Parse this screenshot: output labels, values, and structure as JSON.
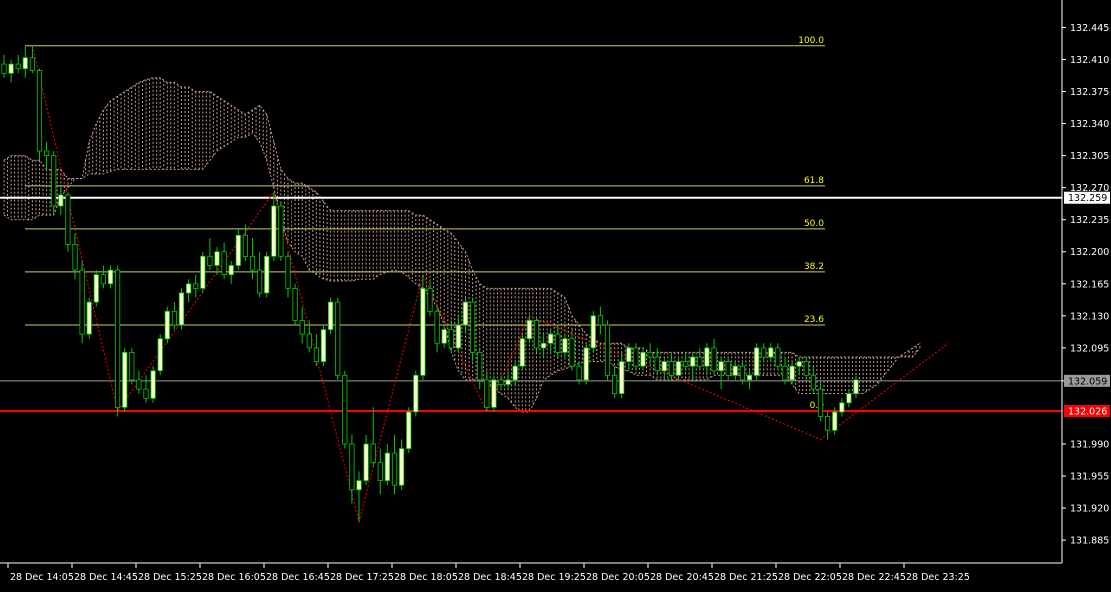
{
  "chart_data": {
    "type": "candlestick",
    "price_range": [
      131.86,
      132.475
    ],
    "y_ticks": [
      "132.445",
      "132.410",
      "132.375",
      "132.340",
      "132.305",
      "132.270",
      "132.235",
      "132.200",
      "132.165",
      "132.130",
      "132.095",
      "132.059",
      "131.990",
      "131.955",
      "131.920",
      "131.885"
    ],
    "x_labels": [
      "28 Dec 14:05",
      "28 Dec 14:45",
      "28 Dec 15:25",
      "28 Dec 16:05",
      "28 Dec 16:45",
      "28 Dec 17:25",
      "28 Dec 18:05",
      "28 Dec 18:45",
      "28 Dec 19:25",
      "28 Dec 20:05",
      "28 Dec 20:45",
      "28 Dec 21:25",
      "28 Dec 22:05",
      "28 Dec 22:45",
      "28 Dec 23:25"
    ],
    "price_markers": [
      {
        "label": "132.259",
        "value": 132.259,
        "color": "#ffffff",
        "text_color": "#000000",
        "line_width": 2
      },
      {
        "label": "132.059",
        "value": 132.059,
        "color": "#9a9a9a",
        "text_color": "#000000",
        "line_width": 1
      },
      {
        "label": "132.026",
        "value": 132.026,
        "color": "#ff0000",
        "text_color": "#ffffff",
        "line_width": 2
      }
    ],
    "fib_levels": [
      {
        "label": "100.0",
        "value": 132.425
      },
      {
        "label": "61.8",
        "value": 132.272
      },
      {
        "label": "50.0",
        "value": 132.225
      },
      {
        "label": "38.2",
        "value": 132.178
      },
      {
        "label": "23.6",
        "value": 132.12
      },
      {
        "label": "0.0",
        "value": 132.026
      }
    ],
    "colors": {
      "background": "#000000",
      "bull_body": "#ffffcc",
      "bear_body": "#000000",
      "wick": "#00cc00",
      "fib_line": "#cccc66",
      "fib_text": "#ffff00",
      "cloud": "#c49b8a",
      "zigzag": "#ff0000",
      "axis_text": "#ffffff"
    },
    "candles": [
      [
        132.405,
        132.415,
        132.39,
        132.395
      ],
      [
        132.395,
        132.41,
        132.385,
        132.405
      ],
      [
        132.405,
        132.415,
        132.395,
        132.4
      ],
      [
        132.4,
        132.425,
        132.39,
        132.412
      ],
      [
        132.412,
        132.425,
        132.395,
        132.398
      ],
      [
        132.398,
        132.4,
        132.3,
        132.31
      ],
      [
        132.31,
        132.32,
        132.29,
        132.305
      ],
      [
        132.305,
        132.31,
        132.24,
        132.25
      ],
      [
        132.25,
        132.27,
        132.24,
        132.262
      ],
      [
        132.262,
        132.265,
        132.2,
        132.208
      ],
      [
        132.208,
        132.22,
        132.17,
        132.18
      ],
      [
        132.18,
        132.19,
        132.1,
        132.11
      ],
      [
        132.11,
        132.15,
        132.105,
        132.145
      ],
      [
        132.145,
        132.18,
        132.14,
        132.175
      ],
      [
        132.175,
        132.185,
        132.16,
        132.165
      ],
      [
        132.165,
        132.185,
        132.16,
        132.18
      ],
      [
        132.18,
        132.185,
        132.02,
        132.03
      ],
      [
        132.03,
        132.095,
        132.025,
        132.09
      ],
      [
        132.09,
        132.095,
        132.055,
        132.06
      ],
      [
        132.06,
        132.07,
        132.045,
        132.05
      ],
      [
        132.05,
        132.065,
        132.035,
        132.04
      ],
      [
        132.04,
        132.075,
        132.035,
        132.07
      ],
      [
        132.07,
        132.11,
        132.065,
        132.105
      ],
      [
        132.105,
        132.14,
        132.1,
        132.135
      ],
      [
        132.135,
        132.145,
        132.115,
        132.12
      ],
      [
        132.12,
        132.16,
        132.115,
        132.155
      ],
      [
        132.155,
        132.17,
        132.145,
        132.165
      ],
      [
        132.165,
        132.175,
        132.15,
        132.16
      ],
      [
        132.16,
        132.2,
        132.155,
        132.195
      ],
      [
        132.195,
        132.215,
        132.18,
        132.185
      ],
      [
        132.185,
        132.205,
        132.175,
        132.2
      ],
      [
        132.2,
        132.21,
        132.17,
        132.175
      ],
      [
        132.175,
        132.19,
        132.165,
        132.185
      ],
      [
        132.185,
        132.225,
        132.18,
        132.218
      ],
      [
        132.218,
        132.23,
        132.19,
        132.195
      ],
      [
        132.195,
        132.215,
        132.17,
        132.18
      ],
      [
        132.18,
        132.2,
        132.15,
        132.155
      ],
      [
        132.155,
        132.2,
        132.15,
        132.195
      ],
      [
        132.195,
        132.265,
        132.19,
        132.25
      ],
      [
        132.25,
        132.255,
        132.19,
        132.195
      ],
      [
        132.195,
        132.2,
        132.15,
        132.16
      ],
      [
        132.16,
        132.165,
        132.12,
        132.125
      ],
      [
        132.125,
        132.14,
        132.1,
        132.11
      ],
      [
        132.11,
        132.125,
        132.09,
        132.095
      ],
      [
        132.095,
        132.11,
        132.075,
        132.08
      ],
      [
        132.08,
        132.12,
        132.075,
        132.115
      ],
      [
        132.115,
        132.15,
        132.11,
        132.145
      ],
      [
        132.145,
        132.15,
        132.06,
        132.065
      ],
      [
        132.065,
        132.07,
        131.985,
        131.99
      ],
      [
        131.99,
        132.0,
        131.925,
        131.94
      ],
      [
        131.94,
        131.96,
        131.905,
        131.95
      ],
      [
        131.95,
        132.0,
        131.945,
        131.99
      ],
      [
        131.99,
        132.03,
        131.965,
        131.97
      ],
      [
        131.97,
        131.985,
        131.935,
        131.95
      ],
      [
        131.95,
        131.99,
        131.945,
        131.98
      ],
      [
        131.98,
        132.0,
        131.935,
        131.945
      ],
      [
        131.945,
        131.995,
        131.94,
        131.985
      ],
      [
        131.985,
        132.03,
        131.98,
        132.025
      ],
      [
        132.025,
        132.07,
        132.02,
        132.065
      ],
      [
        132.065,
        132.175,
        132.06,
        132.16
      ],
      [
        132.16,
        132.17,
        132.13,
        132.135
      ],
      [
        132.135,
        132.14,
        132.09,
        132.1
      ],
      [
        132.1,
        132.12,
        132.095,
        132.115
      ],
      [
        132.115,
        132.125,
        132.09,
        132.095
      ],
      [
        132.095,
        132.13,
        132.09,
        132.12
      ],
      [
        132.12,
        132.15,
        132.11,
        132.145
      ],
      [
        132.145,
        132.15,
        132.08,
        132.09
      ],
      [
        132.09,
        132.095,
        132.05,
        132.06
      ],
      [
        132.06,
        132.07,
        132.025,
        132.03
      ],
      [
        132.03,
        132.065,
        132.025,
        132.06
      ],
      [
        132.06,
        132.065,
        132.05,
        132.055
      ],
      [
        132.055,
        132.07,
        132.05,
        132.06
      ],
      [
        132.06,
        132.08,
        132.055,
        132.075
      ],
      [
        132.075,
        132.11,
        132.07,
        132.105
      ],
      [
        132.105,
        132.13,
        132.1,
        132.125
      ],
      [
        132.125,
        132.13,
        132.09,
        132.095
      ],
      [
        132.095,
        132.11,
        132.085,
        132.1
      ],
      [
        132.1,
        132.115,
        132.09,
        132.11
      ],
      [
        132.11,
        132.12,
        132.085,
        132.09
      ],
      [
        132.09,
        132.11,
        132.085,
        132.105
      ],
      [
        132.105,
        132.115,
        132.07,
        132.075
      ],
      [
        132.075,
        132.08,
        132.055,
        132.06
      ],
      [
        132.06,
        132.1,
        132.055,
        132.095
      ],
      [
        132.095,
        132.135,
        132.09,
        132.13
      ],
      [
        132.13,
        132.14,
        132.11,
        132.12
      ],
      [
        132.12,
        132.125,
        132.06,
        132.065
      ],
      [
        132.065,
        132.075,
        132.04,
        132.045
      ],
      [
        132.045,
        132.09,
        132.04,
        132.08
      ],
      [
        132.08,
        132.1,
        132.07,
        132.095
      ],
      [
        132.095,
        132.1,
        132.07,
        132.075
      ],
      [
        132.075,
        132.095,
        132.07,
        132.09
      ],
      [
        132.09,
        132.1,
        132.075,
        132.085
      ],
      [
        132.085,
        132.095,
        132.065,
        132.07
      ],
      [
        132.07,
        132.085,
        132.06,
        132.08
      ],
      [
        132.08,
        132.09,
        132.06,
        132.065
      ],
      [
        132.065,
        132.085,
        132.06,
        132.08
      ],
      [
        132.08,
        132.09,
        132.07,
        132.075
      ],
      [
        132.075,
        132.09,
        132.06,
        132.085
      ],
      [
        132.085,
        132.095,
        132.07,
        132.075
      ],
      [
        132.075,
        132.1,
        132.065,
        132.095
      ],
      [
        132.095,
        132.105,
        132.065,
        132.07
      ],
      [
        132.07,
        132.085,
        132.05,
        132.08
      ],
      [
        132.08,
        132.085,
        132.06,
        132.065
      ],
      [
        132.065,
        132.08,
        132.06,
        132.075
      ],
      [
        132.075,
        132.08,
        132.055,
        132.06
      ],
      [
        132.06,
        132.07,
        132.05,
        132.065
      ],
      [
        132.065,
        132.1,
        132.06,
        132.095
      ],
      [
        132.095,
        132.1,
        132.08,
        132.085
      ],
      [
        132.085,
        132.1,
        132.08,
        132.095
      ],
      [
        132.095,
        132.1,
        132.07,
        132.075
      ],
      [
        132.075,
        132.085,
        132.055,
        132.06
      ],
      [
        132.06,
        132.08,
        132.055,
        132.075
      ],
      [
        132.075,
        132.085,
        132.065,
        132.08
      ],
      [
        132.08,
        132.085,
        132.06,
        132.065
      ],
      [
        132.065,
        132.075,
        132.045,
        132.05
      ],
      [
        132.05,
        132.06,
        132.015,
        132.02
      ],
      [
        132.02,
        132.025,
        131.995,
        132.005
      ],
      [
        132.005,
        132.03,
        132.0,
        132.025
      ],
      [
        132.025,
        132.04,
        132.02,
        132.035
      ],
      [
        132.035,
        132.05,
        132.03,
        132.045
      ],
      [
        132.045,
        132.065,
        132.04,
        132.06
      ]
    ],
    "cloud": {
      "start_index": 0,
      "top": [
        132.3,
        132.305,
        132.305,
        132.305,
        132.3,
        132.3,
        132.29,
        132.29,
        132.29,
        132.28,
        132.28,
        132.28,
        132.32,
        132.34,
        132.355,
        132.365,
        132.37,
        132.375,
        132.38,
        132.385,
        132.388,
        132.39,
        132.39,
        132.385,
        132.385,
        132.38,
        132.38,
        132.375,
        132.375,
        132.375,
        132.37,
        132.365,
        132.36,
        132.355,
        132.35,
        132.355,
        132.36,
        132.35,
        132.32,
        132.29,
        132.28,
        132.275,
        132.275,
        132.27,
        132.265,
        132.255,
        132.245,
        132.245,
        132.245,
        132.245,
        132.245,
        132.245,
        132.245,
        132.245,
        132.245,
        132.245,
        132.245,
        132.245,
        132.24,
        132.24,
        132.235,
        132.23,
        132.225,
        132.22,
        132.21,
        132.2,
        132.18,
        132.165,
        132.16,
        132.16,
        132.16,
        132.16,
        132.16,
        132.16,
        132.16,
        132.16,
        132.16,
        132.16,
        132.155,
        132.15,
        132.13,
        132.12,
        132.11,
        132.105,
        132.1,
        132.1,
        132.1,
        132.1,
        132.095,
        132.095,
        132.095,
        132.09,
        132.09,
        132.09,
        132.09,
        132.09,
        132.09,
        132.09,
        132.09,
        132.09,
        132.09,
        132.09,
        132.09,
        132.09,
        132.09,
        132.09,
        132.09,
        132.09,
        132.09,
        132.09,
        132.09,
        132.09,
        132.085,
        132.085,
        132.085,
        132.085,
        132.085,
        132.085,
        132.085,
        132.085,
        132.085,
        132.085,
        132.085,
        132.085,
        132.085,
        132.085,
        132.085,
        132.085,
        132.085,
        132.095
      ],
      "bottom": [
        132.24,
        132.235,
        132.235,
        132.235,
        132.235,
        132.24,
        132.24,
        132.24,
        132.26,
        132.27,
        132.28,
        132.28,
        132.285,
        132.285,
        132.285,
        132.288,
        132.29,
        132.29,
        132.29,
        132.29,
        132.29,
        132.29,
        132.29,
        132.29,
        132.29,
        132.29,
        132.29,
        132.29,
        132.29,
        132.3,
        132.31,
        132.315,
        132.32,
        132.325,
        132.325,
        132.33,
        132.32,
        132.3,
        132.27,
        132.235,
        132.21,
        132.2,
        132.195,
        132.18,
        132.175,
        132.17,
        132.168,
        132.168,
        132.168,
        132.168,
        132.17,
        132.17,
        132.17,
        132.175,
        132.178,
        132.18,
        132.178,
        132.172,
        132.165,
        132.16,
        132.15,
        132.14,
        132.12,
        132.09,
        132.07,
        132.06,
        132.06,
        132.06,
        132.055,
        132.05,
        132.045,
        132.04,
        132.03,
        132.025,
        132.025,
        132.04,
        132.06,
        132.065,
        132.07,
        132.072,
        132.075,
        132.078,
        132.08,
        132.08,
        132.08,
        132.08,
        132.075,
        132.07,
        132.07,
        132.065,
        132.065,
        132.065,
        132.06,
        132.06,
        132.06,
        132.06,
        132.06,
        132.06,
        132.06,
        132.06,
        132.065,
        132.065,
        132.065,
        132.065,
        132.065,
        132.065,
        132.065,
        132.065,
        132.065,
        132.065,
        132.065,
        132.055,
        132.045,
        132.045,
        132.045,
        132.045,
        132.045,
        132.045,
        132.045,
        132.045,
        132.045,
        132.045,
        132.05,
        132.055,
        132.065,
        132.075,
        132.085,
        132.09,
        132.095,
        132.1
      ]
    },
    "zigzag": [
      [
        4,
        132.425
      ],
      [
        16,
        132.026
      ],
      [
        38,
        132.265
      ],
      [
        50,
        131.905
      ],
      [
        59,
        132.175
      ],
      [
        68,
        132.025
      ],
      [
        74,
        132.13
      ],
      [
        115,
        131.995
      ],
      [
        133,
        132.1
      ]
    ]
  }
}
